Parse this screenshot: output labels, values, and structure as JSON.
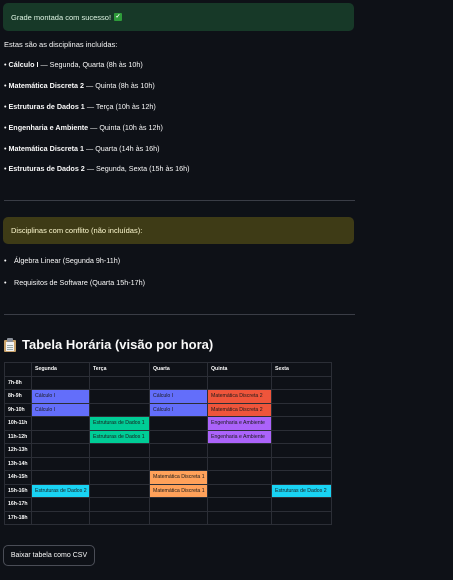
{
  "success_message": "Grade montada com sucesso!",
  "intro": "Estas são as disciplinas incluídas:",
  "courses": [
    {
      "name": "Cálculo I",
      "schedule": "— Segunda, Quarta (8h às 10h)"
    },
    {
      "name": "Matemática Discreta 2",
      "schedule": "— Quinta (8h às 10h)"
    },
    {
      "name": "Estruturas de Dados 1",
      "schedule": "— Terça (10h às 12h)"
    },
    {
      "name": "Engenharia e Ambiente",
      "schedule": "— Quinta (10h às 12h)"
    },
    {
      "name": "Matemática Discreta 1",
      "schedule": "— Quarta (14h às 16h)"
    },
    {
      "name": "Estruturas de Dados 2",
      "schedule": "— Segunda, Sexta (15h às 16h)"
    }
  ],
  "conflict_title": "Disciplinas com conflito (não incluídas):",
  "conflicts": [
    "Álgebra Linear (Segunda 9h-11h)",
    "Requisitos de Software (Quarta 15h-17h)"
  ],
  "table_title": "Tabela Horária (visão por hora)",
  "days": [
    "Segunda",
    "Terça",
    "Quarta",
    "Quinta",
    "Sexta"
  ],
  "colors": {
    "Cálculo I": "#636efa",
    "Matemática Discreta 2": "#ef553b",
    "Estruturas de Dados 1": "#00cc96",
    "Engenharia e Ambiente": "#ab63fa",
    "Matemática Discreta 1": "#ffa15a",
    "Estruturas de Dados 2": "#19d3f3"
  },
  "rows": [
    {
      "time": "7h-8h",
      "cells": [
        "",
        "",
        "",
        "",
        ""
      ]
    },
    {
      "time": "8h-9h",
      "cells": [
        "Cálculo I",
        "",
        "Cálculo I",
        "Matemática Discreta 2",
        ""
      ]
    },
    {
      "time": "9h-10h",
      "cells": [
        "Cálculo I",
        "",
        "Cálculo I",
        "Matemática Discreta 2",
        ""
      ]
    },
    {
      "time": "10h-11h",
      "cells": [
        "",
        "Estruturas de Dados 1",
        "",
        "Engenharia e Ambiente",
        ""
      ]
    },
    {
      "time": "11h-12h",
      "cells": [
        "",
        "Estruturas de Dados 1",
        "",
        "Engenharia e Ambiente",
        ""
      ]
    },
    {
      "time": "12h-13h",
      "cells": [
        "",
        "",
        "",
        "",
        ""
      ]
    },
    {
      "time": "13h-14h",
      "cells": [
        "",
        "",
        "",
        "",
        ""
      ]
    },
    {
      "time": "14h-15h",
      "cells": [
        "",
        "",
        "Matemática Discreta 1",
        "",
        ""
      ]
    },
    {
      "time": "15h-16h",
      "cells": [
        "Estruturas de Dados 2",
        "",
        "Matemática Discreta 1",
        "",
        "Estruturas de Dados 2"
      ]
    },
    {
      "time": "16h-17h",
      "cells": [
        "",
        "",
        "",
        "",
        ""
      ]
    },
    {
      "time": "17h-18h",
      "cells": [
        "",
        "",
        "",
        "",
        ""
      ]
    }
  ],
  "download_label": "Baixar tabela como CSV"
}
